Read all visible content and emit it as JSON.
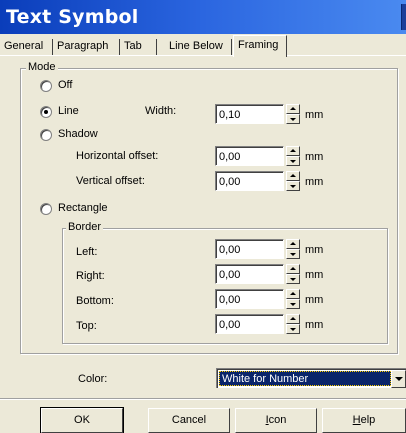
{
  "window": {
    "title": "Text Symbol"
  },
  "tabs": [
    {
      "label": "General",
      "active": false
    },
    {
      "label": "Paragraph",
      "active": false
    },
    {
      "label": "Tab",
      "active": false
    },
    {
      "label": "Line Below",
      "active": false
    },
    {
      "label": "Framing",
      "active": true
    }
  ],
  "mode": {
    "caption": "Mode",
    "options": {
      "off": {
        "label": "Off",
        "selected": false
      },
      "line": {
        "label": "Line",
        "selected": true
      },
      "shadow": {
        "label": "Shadow",
        "selected": false
      },
      "rectangle": {
        "label": "Rectangle",
        "selected": false
      }
    },
    "line_width": {
      "label": "Width:",
      "value": "0,10",
      "unit": "mm"
    },
    "shadow_h": {
      "label": "Horizontal offset:",
      "value": "0,00",
      "unit": "mm"
    },
    "shadow_v": {
      "label": "Vertical offset:",
      "value": "0,00",
      "unit": "mm"
    }
  },
  "border": {
    "caption": "Border",
    "left": {
      "label": "Left:",
      "value": "0,00",
      "unit": "mm"
    },
    "right": {
      "label": "Right:",
      "value": "0,00",
      "unit": "mm"
    },
    "bottom": {
      "label": "Bottom:",
      "value": "0,00",
      "unit": "mm"
    },
    "top": {
      "label": "Top:",
      "value": "0,00",
      "unit": "mm"
    }
  },
  "color": {
    "label": "Color:",
    "value": "White for Number"
  },
  "buttons": {
    "ok": "OK",
    "cancel": "Cancel",
    "icon_rest": "con",
    "icon_mnemonic": "I",
    "help_rest": "elp",
    "help_mnemonic": "H"
  }
}
